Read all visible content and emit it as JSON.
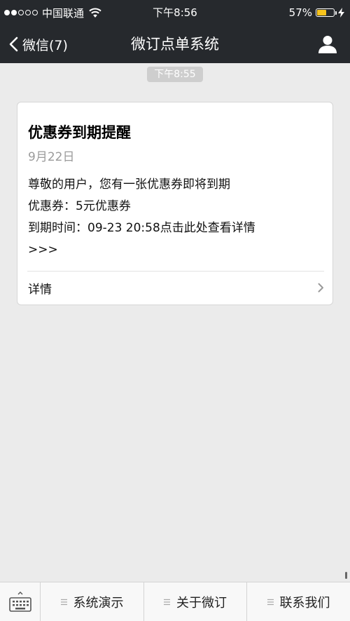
{
  "status_bar": {
    "carrier": "中国联通",
    "time": "下午8:56",
    "battery_percent": "57%",
    "battery_level": 0.57,
    "signal_bars_filled": 2,
    "signal_bars_total": 5
  },
  "nav": {
    "back_label": "微信(7)",
    "title": "微订点单系统"
  },
  "chat": {
    "timestamp": "下午8:55",
    "card": {
      "title": "优惠券到期提醒",
      "date": "9月22日",
      "lines": [
        "尊敬的用户，您有一张优惠券即将到期",
        "优惠券：5元优惠券",
        "到期时间：09-23 20:58点击此处查看详情",
        ">>>"
      ],
      "detail_label": "详情"
    }
  },
  "bottom_menu": {
    "items": [
      {
        "label": "系统演示"
      },
      {
        "label": "关于微订"
      },
      {
        "label": "联系我们"
      }
    ]
  },
  "colors": {
    "header_bg": "#26292d",
    "chat_bg": "#ebebeb",
    "battery_fill": "#f7c31c"
  }
}
